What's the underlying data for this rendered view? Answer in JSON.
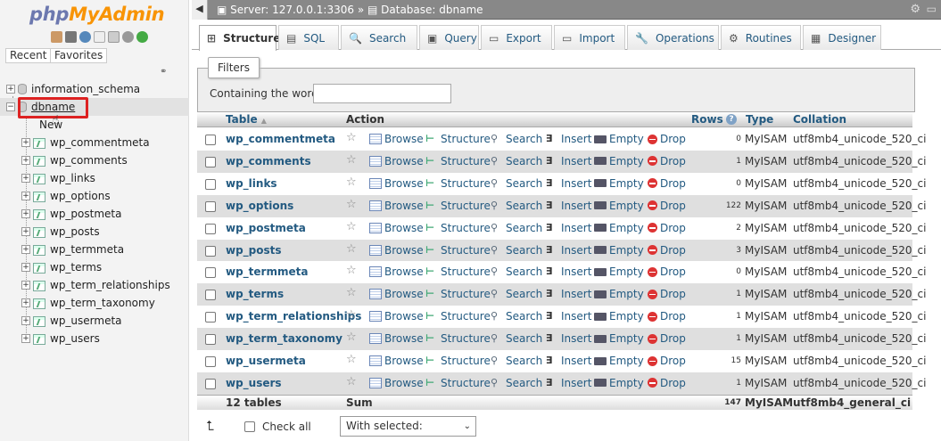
{
  "logo": {
    "part1": "php",
    "part2": "MyAdmin"
  },
  "nav": {
    "recent": "Recent",
    "favorites": "Favorites",
    "databases": [
      {
        "name": "information_schema",
        "expanded": false
      },
      {
        "name": "dbname",
        "expanded": true,
        "selected": true
      }
    ],
    "new_label": "New",
    "tables": [
      "wp_commentmeta",
      "wp_comments",
      "wp_links",
      "wp_options",
      "wp_postmeta",
      "wp_posts",
      "wp_termmeta",
      "wp_terms",
      "wp_term_relationships",
      "wp_term_taxonomy",
      "wp_usermeta",
      "wp_users"
    ]
  },
  "breadcrumb": {
    "server": "Server: 127.0.0.1:3306",
    "sep": "»",
    "database": "Database: dbname"
  },
  "tabs": [
    {
      "label": "Structure",
      "icon": "structure-icon",
      "active": true
    },
    {
      "label": "SQL",
      "icon": "sql-icon"
    },
    {
      "label": "Search",
      "icon": "search-icon"
    },
    {
      "label": "Query",
      "icon": "query-icon"
    },
    {
      "label": "Export",
      "icon": "export-icon"
    },
    {
      "label": "Import",
      "icon": "import-icon"
    },
    {
      "label": "Operations",
      "icon": "wrench-icon"
    },
    {
      "label": "Routines",
      "icon": "routines-icon"
    },
    {
      "label": "Designer",
      "icon": "designer-icon"
    }
  ],
  "filters": {
    "legend": "Filters",
    "label": "Containing the word:",
    "value": ""
  },
  "table": {
    "headers": {
      "table": "Table",
      "sort": "▲",
      "action": "Action",
      "rows": "Rows",
      "type": "Type",
      "collation": "Collation"
    },
    "actions": {
      "browse": "Browse",
      "structure": "Structure",
      "search": "Search",
      "insert": "Insert",
      "empty": "Empty",
      "drop": "Drop"
    },
    "rows": [
      {
        "name": "wp_commentmeta",
        "rows": "0",
        "type": "MyISAM",
        "collation": "utf8mb4_unicode_520_ci"
      },
      {
        "name": "wp_comments",
        "rows": "1",
        "type": "MyISAM",
        "collation": "utf8mb4_unicode_520_ci"
      },
      {
        "name": "wp_links",
        "rows": "0",
        "type": "MyISAM",
        "collation": "utf8mb4_unicode_520_ci"
      },
      {
        "name": "wp_options",
        "rows": "122",
        "type": "MyISAM",
        "collation": "utf8mb4_unicode_520_ci"
      },
      {
        "name": "wp_postmeta",
        "rows": "2",
        "type": "MyISAM",
        "collation": "utf8mb4_unicode_520_ci"
      },
      {
        "name": "wp_posts",
        "rows": "3",
        "type": "MyISAM",
        "collation": "utf8mb4_unicode_520_ci"
      },
      {
        "name": "wp_termmeta",
        "rows": "0",
        "type": "MyISAM",
        "collation": "utf8mb4_unicode_520_ci"
      },
      {
        "name": "wp_terms",
        "rows": "1",
        "type": "MyISAM",
        "collation": "utf8mb4_unicode_520_ci"
      },
      {
        "name": "wp_term_relationships",
        "rows": "1",
        "type": "MyISAM",
        "collation": "utf8mb4_unicode_520_ci"
      },
      {
        "name": "wp_term_taxonomy",
        "rows": "1",
        "type": "MyISAM",
        "collation": "utf8mb4_unicode_520_ci"
      },
      {
        "name": "wp_usermeta",
        "rows": "15",
        "type": "MyISAM",
        "collation": "utf8mb4_unicode_520_ci"
      },
      {
        "name": "wp_users",
        "rows": "1",
        "type": "MyISAM",
        "collation": "utf8mb4_unicode_520_ci"
      }
    ],
    "footer": {
      "count": "12 tables",
      "action": "Sum",
      "rows": "147",
      "type": "MyISAM",
      "collation": "utf8mb4_general_ci"
    }
  },
  "bottom": {
    "check_all": "Check all",
    "with_selected": "With selected:"
  },
  "colors": {
    "link": "#235a81",
    "brand_php": "#6c78af",
    "brand_myadmin": "#f89406",
    "highlight": "#dd2222"
  }
}
